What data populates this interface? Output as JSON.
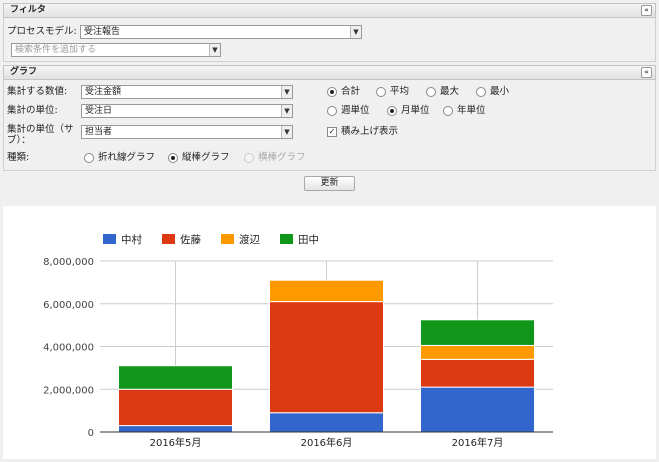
{
  "filter": {
    "header": "フィルタ",
    "collapse_icon": "«",
    "process_model_label": "プロセスモデル:",
    "process_model_value": "受注報告",
    "add_condition_placeholder": "検索条件を追加する"
  },
  "graph": {
    "header": "グラフ",
    "collapse_icon": "«",
    "aggregate_field_label": "集計する数値:",
    "aggregate_field_value": "受注金額",
    "aggregate_funcs": [
      "合計",
      "平均",
      "最大",
      "最小"
    ],
    "aggregate_selected": "合計",
    "unit_label": "集計の単位:",
    "unit_value": "受注日",
    "period_options": [
      "週単位",
      "月単位",
      "年単位"
    ],
    "period_selected": "月単位",
    "sub_unit_label_1": "集計の単位（サ",
    "sub_unit_label_2": "ブ）：",
    "sub_unit_value": "担当者",
    "stacked_label": "積み上げ表示",
    "stacked_checked": true,
    "type_label": "種類:",
    "type_options": [
      "折れ線グラフ",
      "縦棒グラフ",
      "横棒グラフ"
    ],
    "type_selected": "縦棒グラフ",
    "update_button": "更新"
  },
  "colors": {
    "中村": "#3366cc",
    "佐藤": "#dc3912",
    "渡辺": "#ff9900",
    "田中": "#109618"
  },
  "chart_data": {
    "type": "bar",
    "stacked": true,
    "categories": [
      "2016年5月",
      "2016年6月",
      "2016年7月"
    ],
    "series": [
      {
        "name": "中村",
        "values": [
          300000,
          900000,
          2100000
        ]
      },
      {
        "name": "佐藤",
        "values": [
          1700000,
          5200000,
          1300000
        ]
      },
      {
        "name": "渡辺",
        "values": [
          0,
          1000000,
          650000
        ]
      },
      {
        "name": "田中",
        "values": [
          1100000,
          0,
          1200000
        ]
      }
    ],
    "yticks": [
      "0",
      "2,000,000",
      "4,000,000",
      "6,000,000",
      "8,000,000"
    ],
    "ylim": [
      0,
      8000000
    ],
    "legend_position": "top-left",
    "grid": true
  }
}
